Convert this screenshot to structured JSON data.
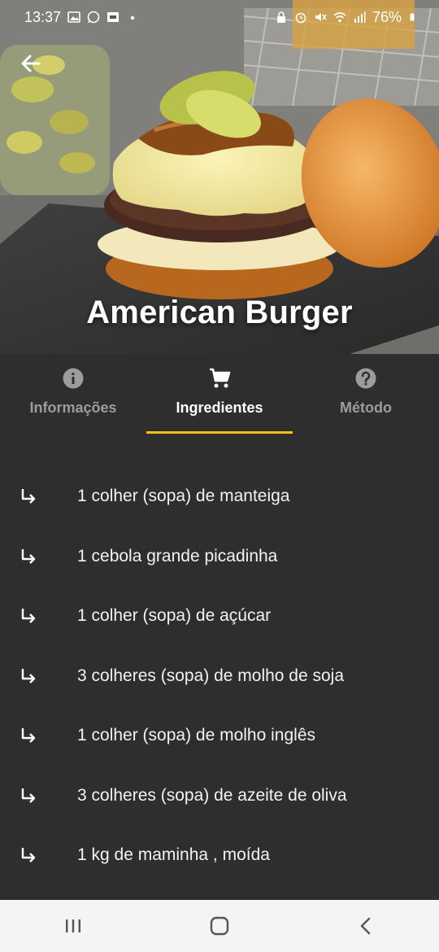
{
  "status_bar": {
    "time": "13:37",
    "battery": "76%",
    "left_icons": [
      "image-icon",
      "whatsapp-icon",
      "cast-icon",
      "dot-icon"
    ],
    "right_icons": [
      "lock-icon",
      "alarm-icon",
      "mute-icon",
      "wifi-icon",
      "signal-icon",
      "battery-icon"
    ]
  },
  "recipe": {
    "title": "American Burger"
  },
  "tabs": [
    {
      "label": "Informações",
      "icon": "info-icon",
      "active": false
    },
    {
      "label": "Ingredientes",
      "icon": "cart-icon",
      "active": true
    },
    {
      "label": "Método",
      "icon": "help-icon",
      "active": false
    }
  ],
  "ingredients": [
    "1 colher (sopa) de manteiga",
    "1 cebola grande picadinha",
    "1 colher (sopa) de açúcar",
    "3 colheres (sopa) de molho de soja",
    "1 colher (sopa) de molho inglês",
    "3 colheres (sopa) de azeite de oliva",
    "1 kg de maminha , moída"
  ],
  "colors": {
    "background": "#2e2e2e",
    "accent": "#f2c21b",
    "inactive_tab": "#9c9c9c",
    "navbar": "#f4f4f4"
  },
  "navbar": {
    "buttons": [
      "recents-icon",
      "home-icon",
      "back-nav-icon"
    ]
  }
}
